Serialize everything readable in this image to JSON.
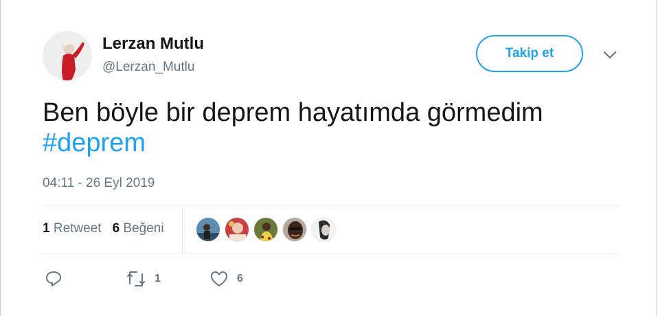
{
  "user": {
    "name": "Lerzan Mutlu",
    "handle": "@Lerzan_Mutlu"
  },
  "follow_label": "Takip et",
  "tweet": {
    "text": "Ben böyle bir deprem hayatımda görmedim",
    "hashtag": "#deprem"
  },
  "timestamp": "04:11 - 26 Eyl 2019",
  "stats": {
    "retweet_count": "1",
    "retweet_label": "Retweet",
    "like_count": "6",
    "like_label": "Beğeni"
  },
  "actions": {
    "retweet_count": "1",
    "like_count": "6"
  },
  "colors": {
    "accent": "#1da1f2",
    "secondary_text": "#657786",
    "primary_text": "#14171a",
    "divider": "#e6ecf0"
  },
  "icons": {
    "menu": "chevron-down-icon",
    "reply": "reply-icon",
    "retweet": "retweet-icon",
    "like": "heart-icon"
  }
}
